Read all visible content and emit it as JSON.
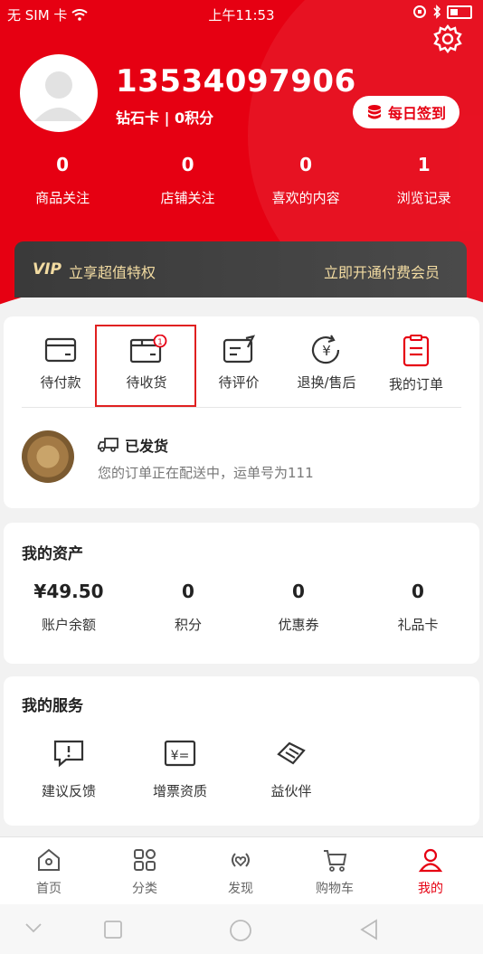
{
  "status_bar": {
    "carrier": "无 SIM 卡",
    "time": "上午11:53"
  },
  "profile": {
    "phone": "13534097906",
    "level_text": "钻石卡 | 0积分",
    "signin_label": "每日签到"
  },
  "stats": [
    {
      "value": "0",
      "label": "商品关注"
    },
    {
      "value": "0",
      "label": "店铺关注"
    },
    {
      "value": "0",
      "label": "喜欢的内容"
    },
    {
      "value": "1",
      "label": "浏览记录"
    }
  ],
  "vip": {
    "icon_text": "VIP",
    "left_text": "立享超值特权",
    "right_text": "立即开通付费会员"
  },
  "orders": {
    "items": [
      {
        "label": "待付款",
        "icon": "wallet-icon"
      },
      {
        "label": "待收货",
        "icon": "package-icon",
        "badge": "1"
      },
      {
        "label": "待评价",
        "icon": "review-icon"
      },
      {
        "label": "退换/售后",
        "icon": "refund-icon"
      },
      {
        "label": "我的订单",
        "icon": "order-list-icon"
      }
    ],
    "shipment": {
      "title": "已发货",
      "desc": "您的订单正在配送中，运单号为111"
    }
  },
  "assets": {
    "title": "我的资产",
    "items": [
      {
        "value": "¥49.50",
        "label": "账户余额"
      },
      {
        "value": "0",
        "label": "积分"
      },
      {
        "value": "0",
        "label": "优惠券"
      },
      {
        "value": "0",
        "label": "礼品卡"
      }
    ]
  },
  "services": {
    "title": "我的服务",
    "items": [
      {
        "label": "建议反馈",
        "icon": "feedback-icon"
      },
      {
        "label": "增票资质",
        "icon": "invoice-icon"
      },
      {
        "label": "益伙伴",
        "icon": "partner-icon"
      }
    ]
  },
  "tabbar": [
    {
      "label": "首页",
      "icon": "home-icon"
    },
    {
      "label": "分类",
      "icon": "category-icon"
    },
    {
      "label": "发现",
      "icon": "discover-icon"
    },
    {
      "label": "购物车",
      "icon": "cart-icon"
    },
    {
      "label": "我的",
      "icon": "profile-icon",
      "active": true
    }
  ],
  "colors": {
    "brand_red": "#e60012",
    "vip_gold": "#f3dca2"
  }
}
